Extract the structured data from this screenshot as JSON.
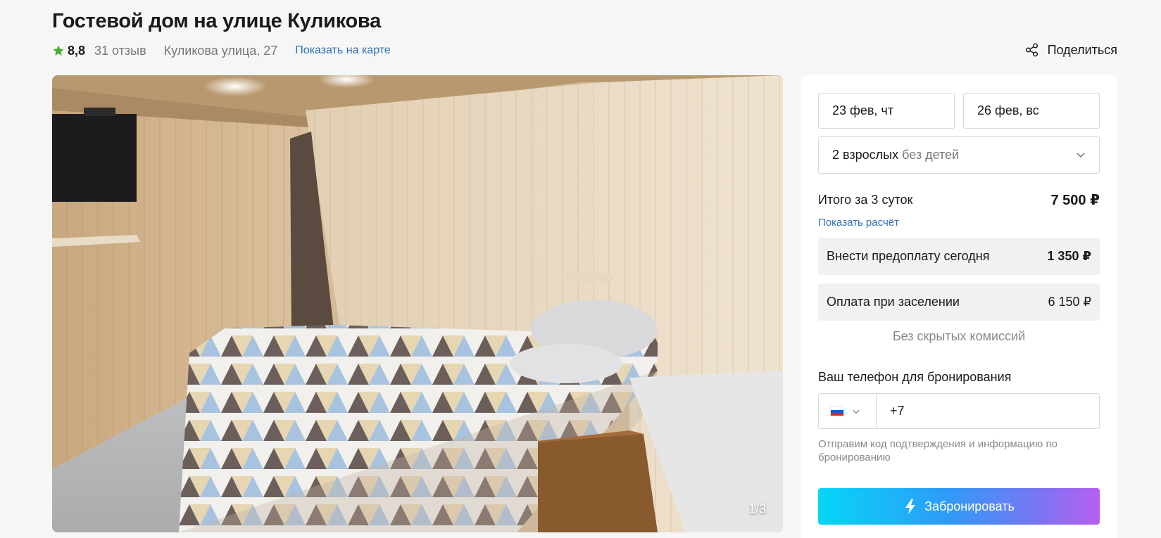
{
  "header": {
    "title": "Гостевой дом на улице Куликова",
    "rating": "8,8",
    "reviews": "31 отзыв",
    "address": "Куликова улица, 27",
    "map_link": "Показать на карте",
    "share": "Поделиться",
    "star_color": "#4caf32"
  },
  "gallery": {
    "counter": "1/3"
  },
  "booking": {
    "check_in": "23 фев, чт",
    "check_out": "26 фев, вс",
    "guests": "2 взрослых",
    "children": "без детей",
    "total_label": "Итого за 3 суток",
    "total_value": "7 500 ₽",
    "calc_link": "Показать расчёт",
    "prepay_label": "Внести предоплату сегодня",
    "prepay_value": "1 350 ₽",
    "checkin_pay_label": "Оплата при заселении",
    "checkin_pay_value": "6 150 ₽",
    "no_fees": "Без скрытых комиссий",
    "phone_label": "Ваш телефон для бронирования",
    "phone_value": "+7",
    "country_flag": "ru-flag",
    "hint": "Отправим код подтверждения и информацию по бронированию",
    "book_button": "Забронировать",
    "accent_gradient": [
      "#06d6f7",
      "#7f73f3",
      "#b760f0"
    ]
  }
}
